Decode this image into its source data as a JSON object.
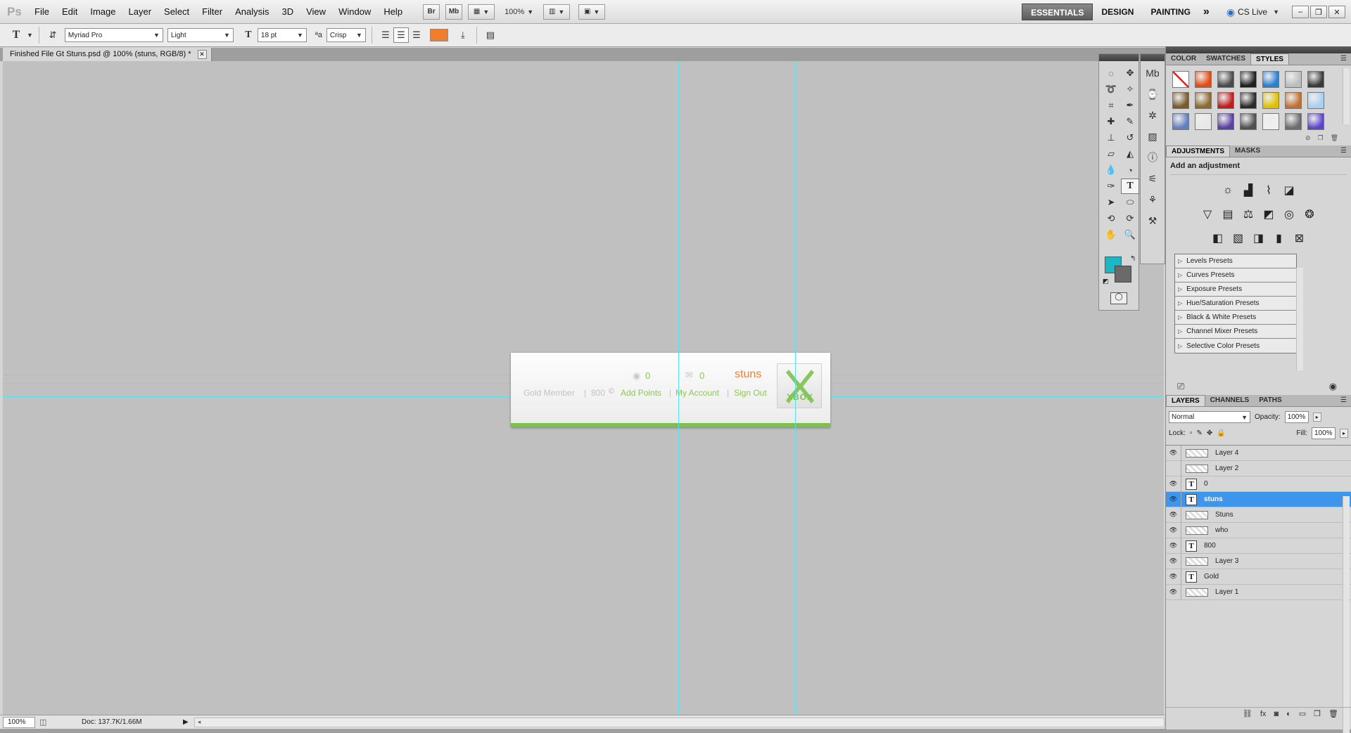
{
  "app": {
    "logo": "Ps"
  },
  "menu": [
    "File",
    "Edit",
    "Image",
    "Layer",
    "Select",
    "Filter",
    "Analysis",
    "3D",
    "View",
    "Window",
    "Help"
  ],
  "menubar_buttons": {
    "bridge": "Br",
    "mini_bridge": "Mb",
    "zoom": "100%"
  },
  "workspaces": {
    "essentials": "ESSENTIALS",
    "design": "DESIGN",
    "painting": "PAINTING",
    "more": "»",
    "cslive": "CS Live"
  },
  "options": {
    "font_family": "Myriad Pro",
    "font_style": "Light",
    "font_size": "18 pt",
    "antialias": "Crisp",
    "text_color": "#f07f2c"
  },
  "document": {
    "tab_title": "Finished File Gt Stuns.psd @ 100% (stuns, RGB/8) *"
  },
  "artboard": {
    "points": "0",
    "messages": "0",
    "gamertag": "stuns",
    "member": "Gold Member",
    "separator": "|",
    "score": "800",
    "add_points": "Add Points",
    "my_account": "My Account",
    "sign_out": "Sign Out",
    "logo_text": "XBOX",
    "accent_green": "#7cc24a",
    "accent_orange": "#f07f2c"
  },
  "status": {
    "zoom": "100%",
    "doc": "Doc: 137.7K/1.66M"
  },
  "color_panel": {
    "tabs": [
      "COLOR",
      "SWATCHES",
      "STYLES"
    ],
    "styles": [
      "#ffffff",
      "#e24b12",
      "#4a4a4a",
      "#1f1f1f",
      "#2a7fd0",
      "#bdbdbd",
      "#3a3a3a",
      "#7a5a2a",
      "#8a6a30",
      "#c21c1c",
      "#2a2a2a",
      "#e0c000",
      "#c07030",
      "#a8d0f0",
      "#6080c0",
      "#e8e8e8",
      "#5a40a0",
      "#505050",
      "#f0f0f0",
      "#6c6c6c",
      "#5e46c8"
    ]
  },
  "adjustments": {
    "tabs": [
      "ADJUSTMENTS",
      "MASKS"
    ],
    "title": "Add an adjustment",
    "presets": [
      "Levels Presets",
      "Curves Presets",
      "Exposure Presets",
      "Hue/Saturation Presets",
      "Black & White Presets",
      "Channel Mixer Presets",
      "Selective Color Presets"
    ]
  },
  "layers_panel": {
    "tabs": [
      "LAYERS",
      "CHANNELS",
      "PATHS"
    ],
    "blend_mode": "Normal",
    "opacity_label": "Opacity:",
    "opacity": "100%",
    "lock_label": "Lock:",
    "fill_label": "Fill:",
    "fill": "100%",
    "layers": [
      {
        "name": "Layer 4",
        "type": "raster",
        "visible": true
      },
      {
        "name": "Layer 2",
        "type": "raster",
        "visible": false
      },
      {
        "name": "0",
        "type": "text",
        "visible": true
      },
      {
        "name": "stuns",
        "type": "text",
        "visible": true,
        "selected": true
      },
      {
        "name": "Stuns",
        "type": "raster",
        "visible": true
      },
      {
        "name": "who",
        "type": "raster",
        "visible": true
      },
      {
        "name": "800",
        "type": "text",
        "visible": true
      },
      {
        "name": "Layer 3",
        "type": "raster",
        "visible": true
      },
      {
        "name": "Gold",
        "type": "text",
        "visible": true
      },
      {
        "name": "Layer 1",
        "type": "raster",
        "visible": true
      }
    ]
  }
}
